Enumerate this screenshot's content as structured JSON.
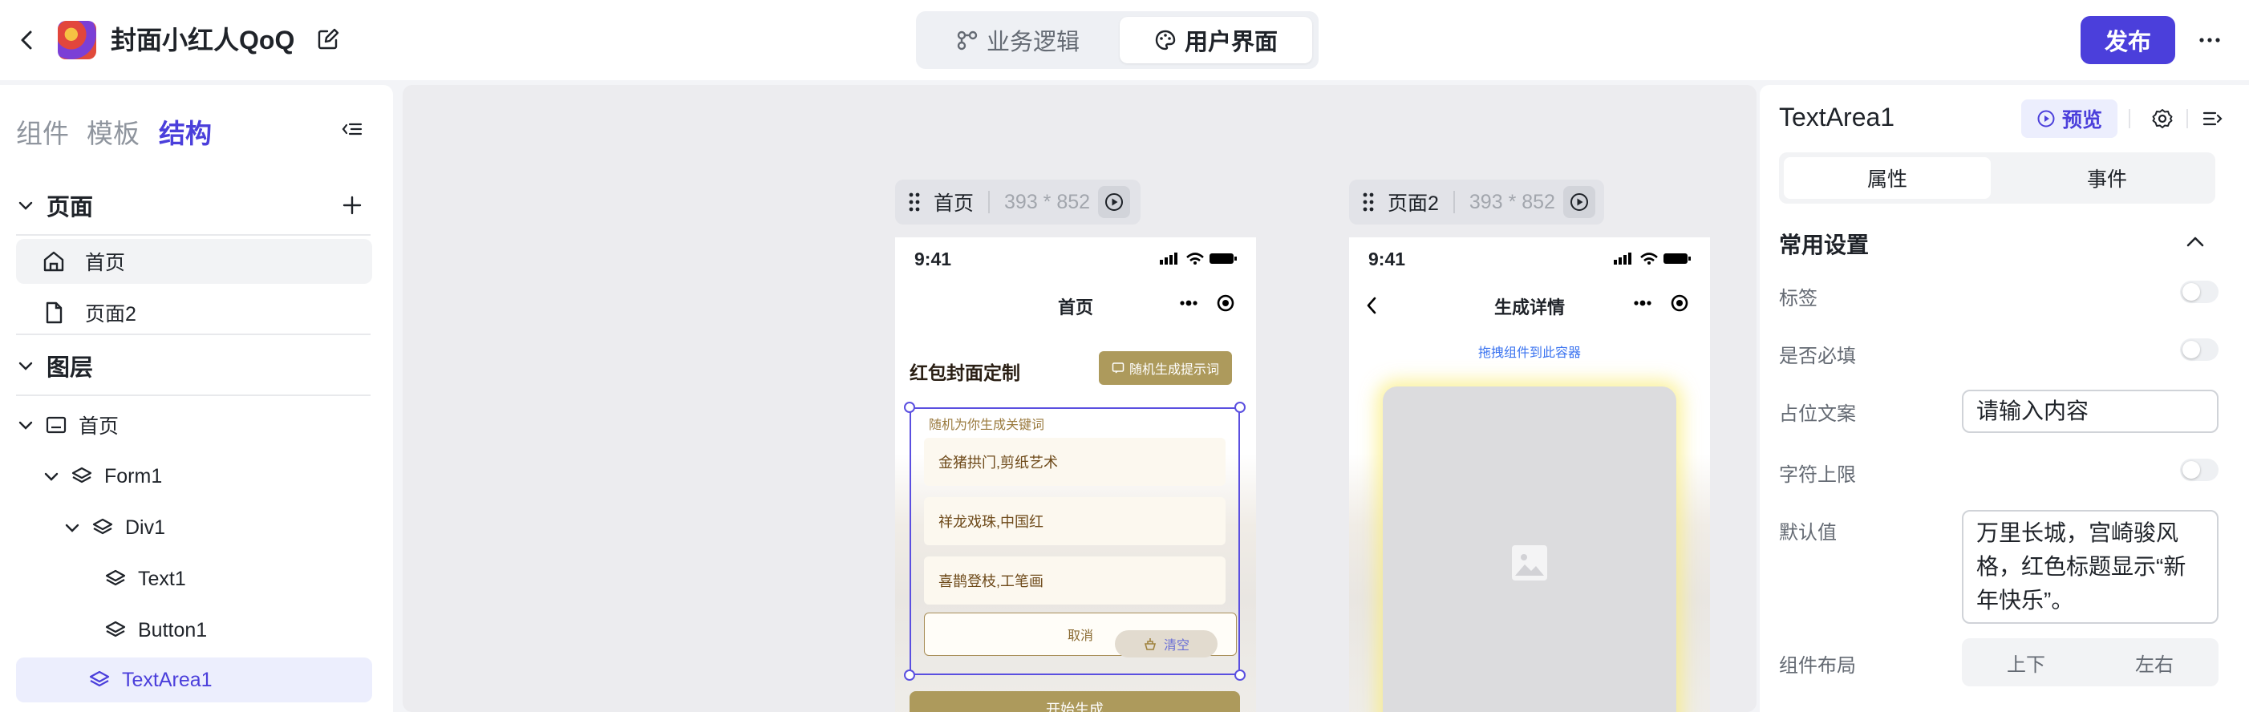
{
  "header": {
    "app_title": "封面小红人QoQ",
    "tab_logic": "业务逻辑",
    "tab_ui": "用户界面",
    "publish_label": "发布"
  },
  "left_panel": {
    "tabs": [
      "组件",
      "模板",
      "结构"
    ],
    "active_tab": "结构",
    "pages_section": "页面",
    "pages": [
      "首页",
      "页面2"
    ],
    "layers_section": "图层",
    "layers": [
      "首页",
      "Form1",
      "Div1",
      "Text1",
      "Button1",
      "TextArea1"
    ],
    "selected_layer": "TextArea1"
  },
  "canvas": {
    "page1": {
      "tag_name": "首页",
      "tag_dims": "393 * 852",
      "status_time": "9:41",
      "nav_title": "首页",
      "heading": "红包封面定制",
      "random_button": "随机生成提示词",
      "keyword_label": "随机为你生成关键词",
      "keywords": [
        "金猪拱门,剪纸艺术",
        "祥龙戏珠,中国红",
        "喜鹊登枝,工笔画"
      ],
      "cancel_label": "取消",
      "clear_label": "清空",
      "start_label": "开始生成"
    },
    "page2": {
      "tag_name": "页面2",
      "tag_dims": "393 * 852",
      "status_time": "9:41",
      "nav_title": "生成详情",
      "drag_hint": "拖拽组件到此容器"
    }
  },
  "right_panel": {
    "component_name": "TextArea1",
    "preview_label": "预览",
    "tab_props": "属性",
    "tab_events": "事件",
    "section_title": "常用设置",
    "label_tag": "标签",
    "label_required": "是否必填",
    "label_placeholder": "占位文案",
    "placeholder_value": "请输入内容",
    "label_maxlen": "字符上限",
    "label_default": "默认值",
    "default_value": "万里长城，宫崎骏风格，红色标题显示“新年快乐”。",
    "label_layout": "组件布局",
    "layout_options": [
      "上下",
      "左右"
    ]
  },
  "colors": {
    "accent": "#4b3fdb",
    "gold_button": "#ad9a5c"
  }
}
